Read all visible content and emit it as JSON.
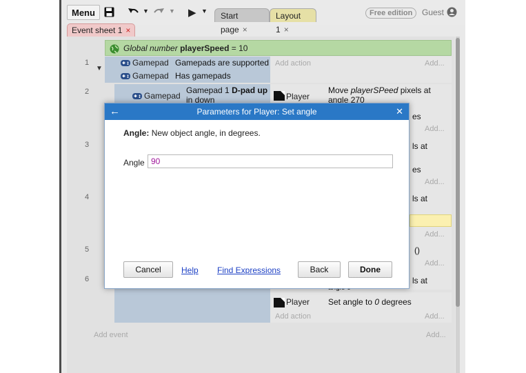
{
  "toolbar": {
    "menu_label": "Menu",
    "tabs": [
      {
        "label": "Start page",
        "close": "×"
      },
      {
        "label": "Layout 1",
        "close": "×"
      }
    ],
    "edition_badge": "Free edition",
    "user": "Guest"
  },
  "sheet_tab": {
    "label": "Event sheet 1",
    "close": "×"
  },
  "global_var": {
    "prefix": "Global number",
    "name": "playerSpeed",
    "value": "= 10"
  },
  "events": {
    "row_numbers": [
      "1",
      "2",
      "3",
      "4",
      "5",
      "6"
    ],
    "row1": {
      "conditions": [
        {
          "object": "Gamepad",
          "text": "Gamepads are supported"
        },
        {
          "object": "Gamepad",
          "text": "Has gamepads"
        }
      ],
      "add_action": "Add action",
      "add_more": "Add..."
    },
    "row2": {
      "condition_object": "Gamepad",
      "condition_text_prefix": "Gamepad 1",
      "condition_text_bold": "D-pad up",
      "condition_text_cut": "in down",
      "action_object": "Player",
      "action_text_prefix": "Move",
      "action_text_italic": "playerSPeed",
      "action_text_suffix": "pixels at",
      "action_text_cut": "angle 270"
    },
    "peek": {
      "es1": "es",
      "add1": "Add...",
      "lsat1": "ls at",
      "es2": "es",
      "add2": "Add...",
      "lsat2": "ls at",
      "add3": "Add...",
      "paren": "()",
      "add4": "Add...",
      "lsat3": "ls at",
      "angle_cut": "angle 0"
    },
    "row6": {
      "action_object": "Player",
      "action_text_prefix": "Set angle to",
      "action_text_italic": "0",
      "action_text_suffix": "degrees",
      "add_action": "Add action",
      "add_more": "Add..."
    },
    "add_event": "Add event",
    "add_event_more": "Add..."
  },
  "dialog": {
    "title": "Parameters for Player: Set angle",
    "description_bold": "Angle:",
    "description": "New object angle, in degrees.",
    "field_label": "Angle",
    "field_value": "90",
    "buttons": {
      "cancel": "Cancel",
      "help": "Help",
      "find_expressions": "Find Expressions",
      "back": "Back",
      "done": "Done"
    }
  },
  "colors": {
    "accent": "#2a78c6",
    "global_var_bg": "#b5d8a3",
    "condition_block_bg": "#b9c8d8",
    "sheet_tab_bg": "#f0c9c9",
    "layout_tab_bg": "#e6e0a6",
    "expression_text": "#a01a9c"
  }
}
